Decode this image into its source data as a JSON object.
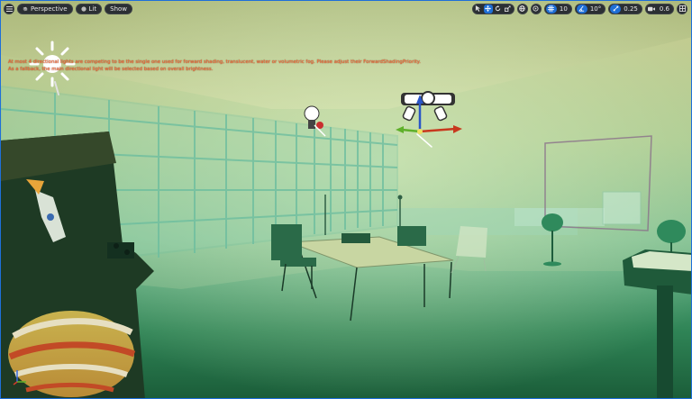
{
  "toolbar": {
    "menu_icon": "hamburger-menu-icon",
    "perspective_label": "Perspective",
    "lit_label": "Lit",
    "show_label": "Show",
    "transform_modes": [
      "select-icon",
      "translate-icon",
      "rotate-icon",
      "scale-icon"
    ],
    "grid_snap_value": "10",
    "rotation_snap_value": "10°",
    "scale_snap_value": "0.25",
    "camera_speed_value": "0.6",
    "accent_color": "#1f6fd6"
  },
  "warning": {
    "line1": "At most 4 directional lights are competing to be the single one used for forward shading, translucent, water or volumetric fog. Please adjust their ForwardShadingPriority.",
    "line2": "As a fallback, the main directional light will be selected based on overall brightness."
  },
  "scene": {
    "description_colors": {
      "fog": "#7fc79a",
      "ceiling": "#b9c98a",
      "floor": "#2f7a4f"
    }
  }
}
